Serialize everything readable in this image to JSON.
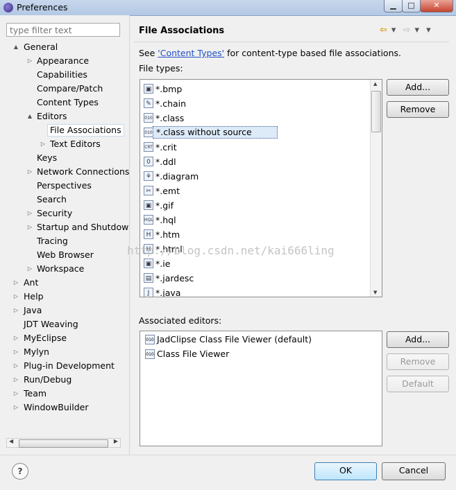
{
  "window": {
    "title": "Preferences",
    "min_glyph": "▁",
    "max_glyph": "□",
    "close_glyph": "✕"
  },
  "filter": {
    "placeholder": "type filter text"
  },
  "tree": [
    {
      "label": "General",
      "level": 0,
      "arrow": "▲"
    },
    {
      "label": "Appearance",
      "level": 1,
      "arrow": "▷"
    },
    {
      "label": "Capabilities",
      "level": 1,
      "arrow": ""
    },
    {
      "label": "Compare/Patch",
      "level": 1,
      "arrow": ""
    },
    {
      "label": "Content Types",
      "level": 1,
      "arrow": ""
    },
    {
      "label": "Editors",
      "level": 1,
      "arrow": "▲"
    },
    {
      "label": "File Associations",
      "level": 2,
      "arrow": "",
      "selected": true
    },
    {
      "label": "Text Editors",
      "level": 2,
      "arrow": "▷"
    },
    {
      "label": "Keys",
      "level": 1,
      "arrow": ""
    },
    {
      "label": "Network Connections",
      "level": 1,
      "arrow": "▷"
    },
    {
      "label": "Perspectives",
      "level": 1,
      "arrow": ""
    },
    {
      "label": "Search",
      "level": 1,
      "arrow": ""
    },
    {
      "label": "Security",
      "level": 1,
      "arrow": "▷"
    },
    {
      "label": "Startup and Shutdown",
      "level": 1,
      "arrow": "▷"
    },
    {
      "label": "Tracing",
      "level": 1,
      "arrow": ""
    },
    {
      "label": "Web Browser",
      "level": 1,
      "arrow": ""
    },
    {
      "label": "Workspace",
      "level": 1,
      "arrow": "▷"
    },
    {
      "label": "Ant",
      "level": 0,
      "arrow": "▷"
    },
    {
      "label": "Help",
      "level": 0,
      "arrow": "▷"
    },
    {
      "label": "Java",
      "level": 0,
      "arrow": "▷"
    },
    {
      "label": "JDT Weaving",
      "level": 0,
      "arrow": ""
    },
    {
      "label": "MyEclipse",
      "level": 0,
      "arrow": "▷"
    },
    {
      "label": "Mylyn",
      "level": 0,
      "arrow": "▷"
    },
    {
      "label": "Plug-in Development",
      "level": 0,
      "arrow": "▷"
    },
    {
      "label": "Run/Debug",
      "level": 0,
      "arrow": "▷"
    },
    {
      "label": "Team",
      "level": 0,
      "arrow": "▷"
    },
    {
      "label": "WindowBuilder",
      "level": 0,
      "arrow": "▷"
    }
  ],
  "page": {
    "title": "File Associations",
    "see_prefix": "See ",
    "see_link": "'Content Types'",
    "see_suffix": " for content-type based file associations.",
    "file_types_label": "File types:",
    "associated_editors_label": "Associated editors:"
  },
  "file_types": [
    {
      "label": "*.bmp",
      "icon": "image-icon",
      "glyph": "▣"
    },
    {
      "label": "*.chain",
      "icon": "pencil-icon",
      "glyph": "✎"
    },
    {
      "label": "*.class",
      "icon": "class-file-icon",
      "glyph": "010"
    },
    {
      "label": "*.class without source",
      "icon": "class-file-icon",
      "glyph": "010",
      "selected": true
    },
    {
      "label": "*.crit",
      "icon": "crit-file-icon",
      "glyph": "CRT"
    },
    {
      "label": "*.ddl",
      "icon": "ddl-file-icon",
      "glyph": "0"
    },
    {
      "label": "*.diagram",
      "icon": "diagram-icon",
      "glyph": "⚘"
    },
    {
      "label": "*.emt",
      "icon": "emt-file-icon",
      "glyph": "✂"
    },
    {
      "label": "*.gif",
      "icon": "image-icon",
      "glyph": "▣"
    },
    {
      "label": "*.hql",
      "icon": "hql-file-icon",
      "glyph": "HQL"
    },
    {
      "label": "*.htm",
      "icon": "html-file-icon",
      "glyph": "H"
    },
    {
      "label": "*.html",
      "icon": "html-file-icon",
      "glyph": "H"
    },
    {
      "label": "*.ie",
      "icon": "image-icon",
      "glyph": "▣"
    },
    {
      "label": "*.jardesc",
      "icon": "jar-file-icon",
      "glyph": "▤"
    },
    {
      "label": "*.java",
      "icon": "java-file-icon",
      "glyph": "J"
    }
  ],
  "file_type_buttons": {
    "add": "Add...",
    "remove": "Remove"
  },
  "associated_editors": [
    {
      "label": "JadClipse Class File Viewer (default)",
      "icon": "class-file-icon",
      "glyph": "010"
    },
    {
      "label": "Class File Viewer",
      "icon": "class-file-icon",
      "glyph": "010"
    }
  ],
  "editor_buttons": {
    "add": "Add...",
    "remove": "Remove",
    "default": "Default"
  },
  "watermark": "http://blog.csdn.net/kai666ling",
  "dialog_buttons": {
    "ok": "OK",
    "cancel": "Cancel",
    "help": "?"
  },
  "nav": {
    "back": "⇦",
    "back_menu": "▾",
    "forward": "⇨",
    "forward_menu": "▾",
    "view_menu": "▾"
  }
}
